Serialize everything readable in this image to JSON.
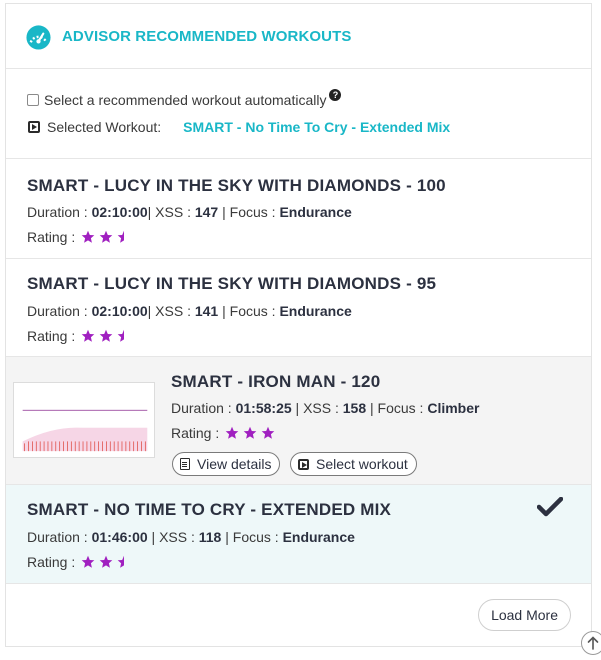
{
  "header": {
    "title": "ADVISOR RECOMMENDED WORKOUTS",
    "icon": "speedometer-icon",
    "accent_color": "#19b7c7"
  },
  "options": {
    "auto_select_label": "Select a recommended workout automatically",
    "auto_select_checked": false,
    "help_icon": "question-circle-icon",
    "selected_label": "Selected Workout:",
    "selected_value": "SMART - No Time To Cry - Extended Mix"
  },
  "workouts": [
    {
      "name": "SMART - LUCY IN THE SKY WITH DIAMONDS - 100",
      "duration_label": "Duration :",
      "duration": "02:10:00",
      "xss_label": "XSS :",
      "xss": "147",
      "focus_label": "Focus :",
      "focus": "Endurance",
      "rating_label": "Rating :",
      "rating": 2.5
    },
    {
      "name": "SMART - LUCY IN THE SKY WITH DIAMONDS - 95",
      "duration_label": "Duration :",
      "duration": "02:10:00",
      "xss_label": "XSS :",
      "xss": "141",
      "focus_label": "Focus :",
      "focus": "Endurance",
      "rating_label": "Rating :",
      "rating": 2.5
    },
    {
      "name": "SMART - IRON MAN - 120",
      "duration_label": "Duration :",
      "duration": "01:58:25",
      "xss_label": "XSS :",
      "xss": "158",
      "focus_label": "Focus :",
      "focus": "Climber",
      "rating_label": "Rating :",
      "rating": 3,
      "view_details_label": "View details",
      "select_workout_label": "Select workout",
      "hovered": true
    },
    {
      "name": "SMART - NO TIME TO CRY - EXTENDED MIX",
      "duration_label": "Duration :",
      "duration": "01:46:00",
      "xss_label": "XSS :",
      "xss": "118",
      "focus_label": "Focus :",
      "focus": "Endurance",
      "rating_label": "Rating :",
      "rating": 2.5,
      "selected": true,
      "selected_icon": "checkmark-icon"
    }
  ],
  "footer": {
    "load_more_label": "Load More",
    "scroll_top_icon": "arrow-up-circle-icon"
  },
  "colors": {
    "star": "#a020c0",
    "title_text": "#2c3140",
    "hover_row": "#f4f4f4",
    "selected_row": "#eef8f9"
  }
}
